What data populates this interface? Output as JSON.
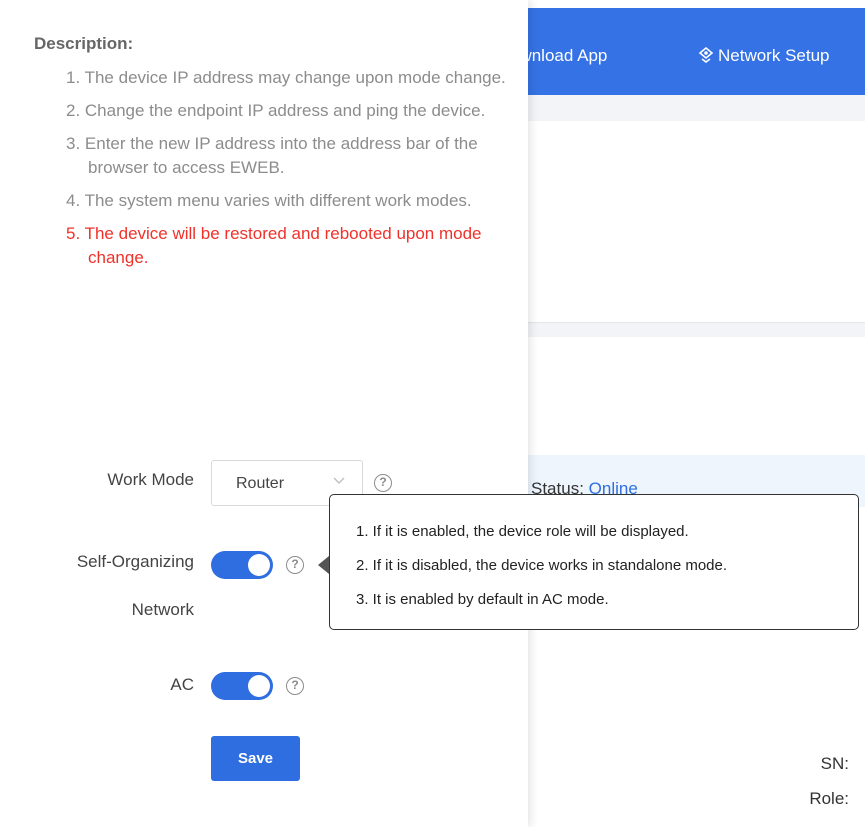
{
  "topbar": {
    "download_label": "ownload App",
    "network_setup_label": "Network Setup"
  },
  "status": {
    "label": "Status: ",
    "value": "Online"
  },
  "device_info": {
    "sn_label": "SN:",
    "role_label": "Role:"
  },
  "description": {
    "title": "Description:",
    "items": [
      "1. The device IP address may change upon mode change.",
      "2. Change the endpoint IP address and ping the device.",
      "3. Enter the new IP address into the address bar of the browser to access EWEB.",
      "4. The system menu varies with different work modes.",
      "5. The device will be restored and rebooted upon mode change."
    ]
  },
  "form": {
    "work_mode_label": "Work Mode",
    "work_mode_value": "Router",
    "self_org_label_line1": "Self-Organizing",
    "self_org_label_line2": "Network",
    "self_org_enabled": true,
    "ac_label": "AC",
    "ac_enabled": true,
    "save_label": "Save"
  },
  "tooltip": {
    "lines": [
      "1. If it is enabled, the device role will be displayed.",
      "2. If it is disabled, the device works in standalone mode.",
      "3. It is enabled by default in AC mode."
    ]
  },
  "colors": {
    "primary": "#2f6ee0",
    "header": "#3572e5",
    "warning": "#f0312a"
  },
  "icons": {
    "help": "question-circle-icon",
    "select_chevron": "chevron-down-icon",
    "network_setup": "network-setup-icon"
  }
}
